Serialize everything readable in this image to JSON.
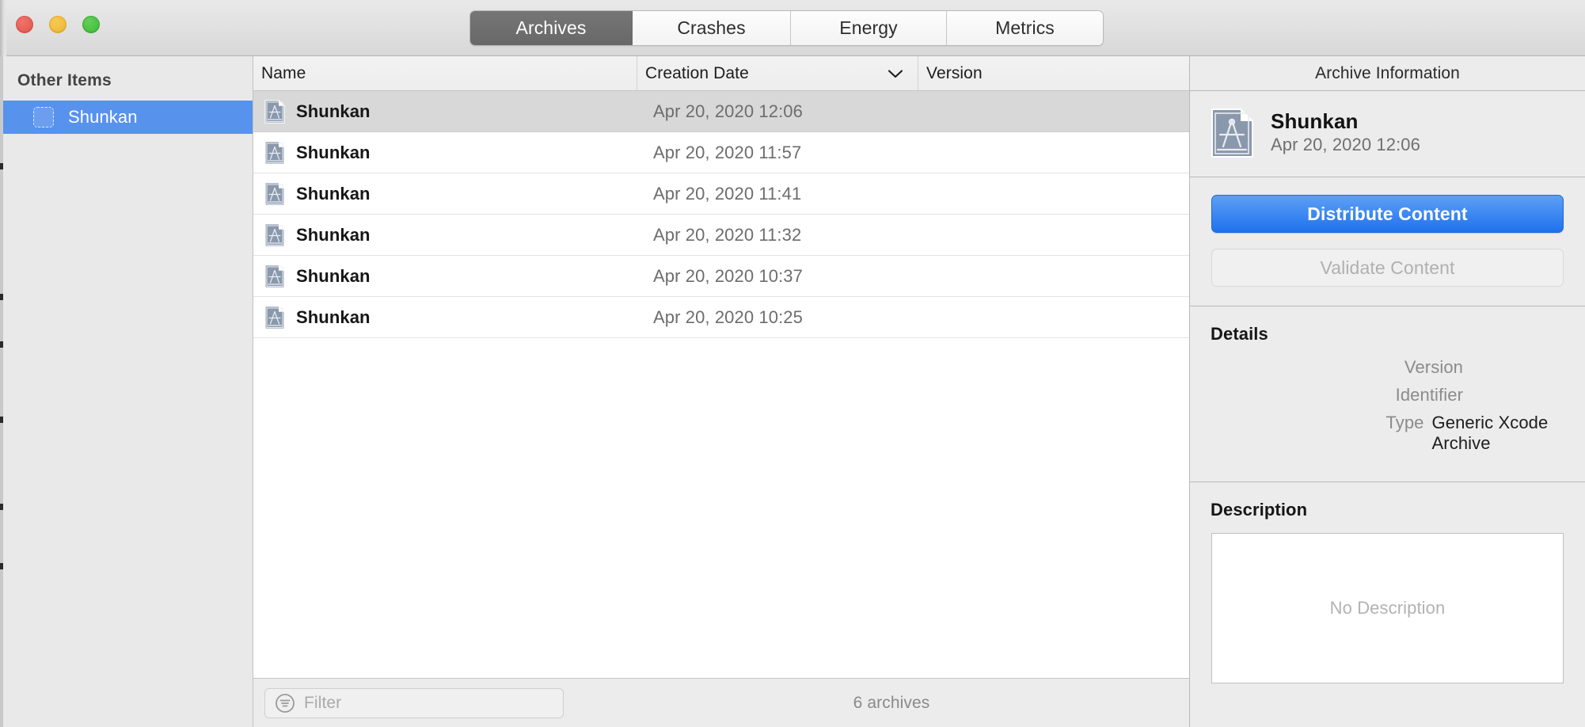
{
  "window": {
    "traffic_lights": [
      "close",
      "minimize",
      "zoom"
    ]
  },
  "tabs": {
    "items": [
      {
        "label": "Archives",
        "selected": true
      },
      {
        "label": "Crashes",
        "selected": false
      },
      {
        "label": "Energy",
        "selected": false
      },
      {
        "label": "Metrics",
        "selected": false
      }
    ]
  },
  "sidebar": {
    "header": "Other Items",
    "items": [
      {
        "label": "Shunkan",
        "selected": true
      }
    ]
  },
  "table": {
    "columns": [
      "Name",
      "Creation Date",
      "Version"
    ],
    "sort": {
      "column": "Creation Date",
      "direction": "descending",
      "icon": "chevron-down-icon"
    },
    "rows": [
      {
        "name": "Shunkan",
        "creation_date": "Apr 20, 2020 12:06",
        "version": "",
        "selected": true
      },
      {
        "name": "Shunkan",
        "creation_date": "Apr 20, 2020 11:57",
        "version": "",
        "selected": false
      },
      {
        "name": "Shunkan",
        "creation_date": "Apr 20, 2020 11:41",
        "version": "",
        "selected": false
      },
      {
        "name": "Shunkan",
        "creation_date": "Apr 20, 2020 11:32",
        "version": "",
        "selected": false
      },
      {
        "name": "Shunkan",
        "creation_date": "Apr 20, 2020 10:37",
        "version": "",
        "selected": false
      },
      {
        "name": "Shunkan",
        "creation_date": "Apr 20, 2020 10:25",
        "version": "",
        "selected": false
      }
    ]
  },
  "footer": {
    "filter_placeholder": "Filter",
    "filter_value": "",
    "filter_icon": "filter-circle-icon",
    "status": "6 archives"
  },
  "inspector": {
    "title": "Archive Information",
    "identity": {
      "icon": "xcode-archive-document-icon",
      "name": "Shunkan",
      "date": "Apr 20, 2020 12:06"
    },
    "actions": {
      "distribute_label": "Distribute Content",
      "validate_label": "Validate Content"
    },
    "details": {
      "title": "Details",
      "rows": [
        {
          "label": "Version",
          "value": ""
        },
        {
          "label": "Identifier",
          "value": ""
        },
        {
          "label": "Type",
          "value": "Generic Xcode Archive"
        }
      ]
    },
    "description": {
      "title": "Description",
      "empty_text": "No Description"
    }
  },
  "colors": {
    "accent_blue": "#1f72ee",
    "selection_blue": "#5792ec",
    "segment_selected": "#6e6e6e",
    "row_selected": "#d8d8d8",
    "window_bg": "#ececec"
  }
}
